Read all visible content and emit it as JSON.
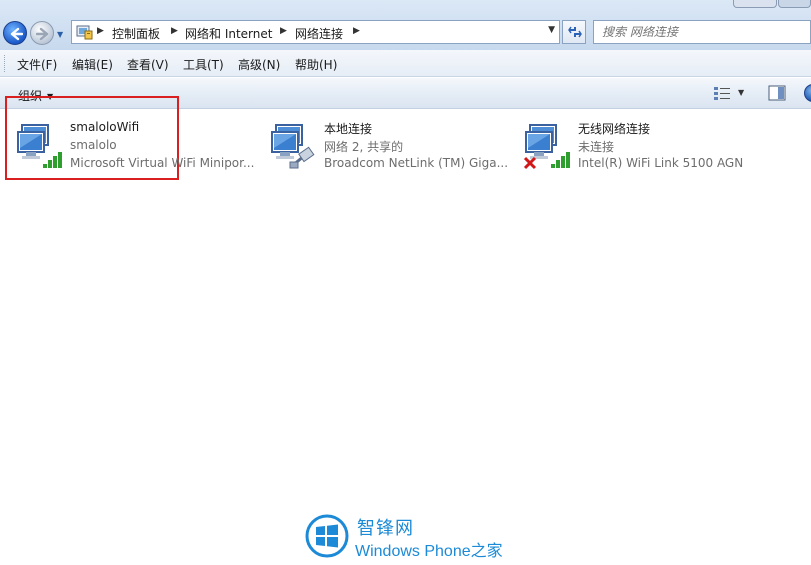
{
  "address_bar": {
    "breadcrumbs": [
      "控制面板",
      "网络和 Internet",
      "网络连接"
    ],
    "search_placeholder": "搜索 网络连接"
  },
  "menu": {
    "items": [
      "文件(F)",
      "编辑(E)",
      "查看(V)",
      "工具(T)",
      "高级(N)",
      "帮助(H)"
    ]
  },
  "toolbar": {
    "organize_label": "组织"
  },
  "connections": [
    {
      "name": "smaloloWifi",
      "status": "smalolo",
      "device": "Microsoft Virtual WiFi Minipor...",
      "icon": "wireless-network-icon",
      "highlighted": true
    },
    {
      "name": "本地连接",
      "status": "网络  2, 共享的",
      "device": "Broadcom NetLink (TM) Giga...",
      "icon": "wired-network-icon"
    },
    {
      "name": "无线网络连接",
      "status": "未连接",
      "device": "Intel(R) WiFi Link 5100 AGN",
      "icon": "wireless-disconnected-icon"
    }
  ],
  "watermark": {
    "line1": "智锋网",
    "line2": "Windows Phone之家"
  },
  "colors": {
    "highlight_border": "#d91f1f",
    "watermark_blue": "#1c8ad6",
    "signal_green": "#2e9e2e"
  }
}
